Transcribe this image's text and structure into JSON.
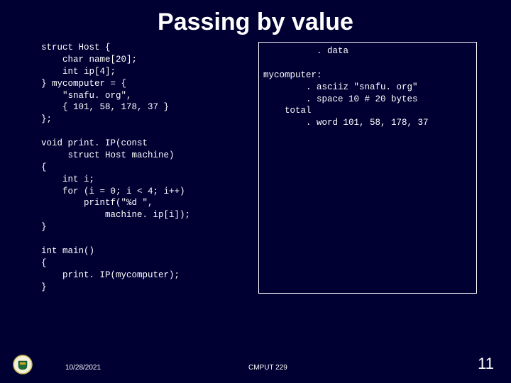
{
  "title": "Passing by value",
  "code_c": "struct Host {\n    char name[20];\n    int ip[4];\n} mycomputer = {\n    \"snafu. org\",\n    { 101, 58, 178, 37 }\n};\n\nvoid print. IP(const\n     struct Host machine)\n{\n    int i;\n    for (i = 0; i < 4; i++)\n        printf(\"%d \",\n            machine. ip[i]);\n}\n\nint main()\n{\n    print. IP(mycomputer);\n}",
  "code_asm": "          . data\n\nmycomputer:\n        . asciiz \"snafu. org\"\n        . space 10 # 20 bytes\n    total\n        . word 101, 58, 178, 37",
  "footer": {
    "date": "10/28/2021",
    "course": "CMPUT 229",
    "page": "11"
  }
}
